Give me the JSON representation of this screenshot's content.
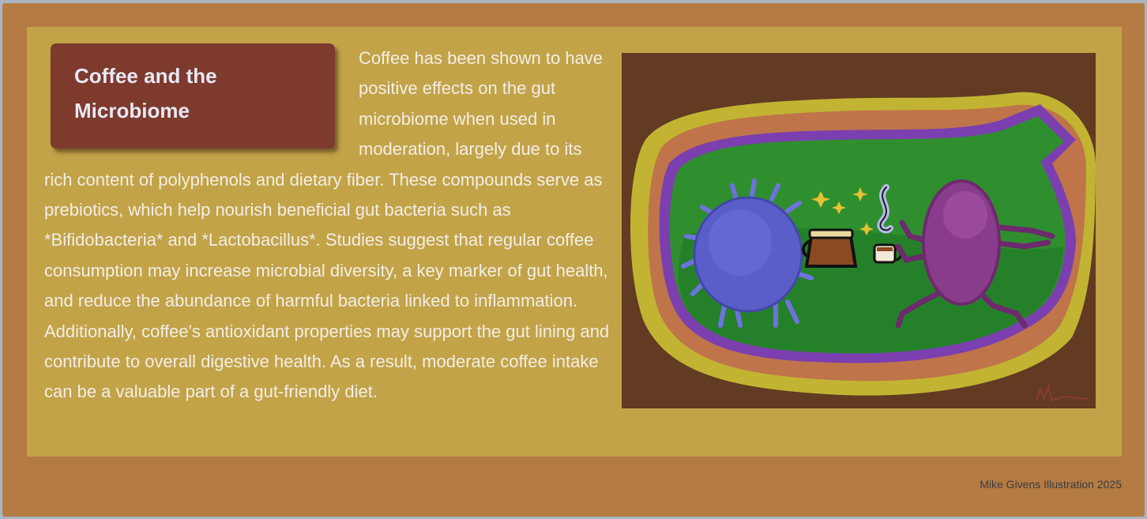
{
  "article": {
    "title": "Coffee and the Microbiome",
    "body": "Coffee has been shown to have positive effects on the gut microbiome when used in moderation, largely due to its rich content of polyphenols and dietary fiber. These compounds serve as prebiotics, which help nourish beneficial gut bacteria such as *Bifidobacteria* and *Lactobacillus*. Studies suggest that regular coffee consumption may increase microbial diversity, a key marker of gut health, and reduce the abundance of harmful bacteria linked to inflammation. Additionally, coffee's antioxidant properties may support the gut lining and contribute to overall digestive health. As a result, moderate coffee intake can be a valuable part of a gut-friendly diet."
  },
  "illustration": {
    "subject": "two microbes sharing coffee in the gut",
    "icons": [
      "blue-microbe-icon",
      "purple-microbe-icon",
      "coffee-pot-icon",
      "coffee-cup-icon",
      "sparkle-icon",
      "steam-icon"
    ],
    "colors": {
      "frame": "#623b22",
      "gut_outer": "#c2b432",
      "gut_mid": "#bf744a",
      "gut_lining": "#7b3fb0",
      "gut_inner": "#2f8f2f",
      "blue_microbe": "#5a5ec8",
      "purple_microbe": "#8a3c8c",
      "coffee": "#8b4a22"
    }
  },
  "footer": {
    "credit": "Mike Givens Illustration 2025"
  },
  "theme": {
    "background": "#b47b43",
    "panel": "#c2a348",
    "title_card": "#7d3a2d",
    "text": "#f3eee6"
  }
}
